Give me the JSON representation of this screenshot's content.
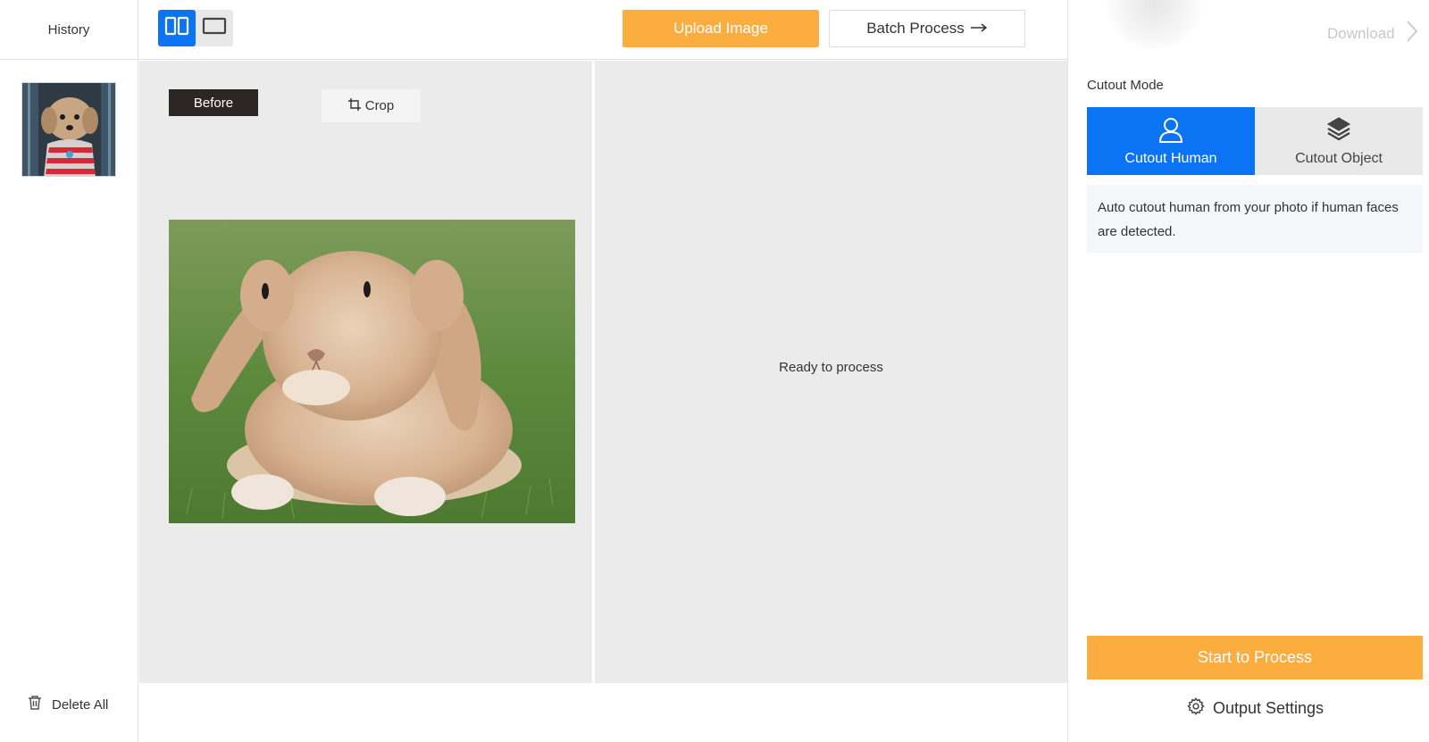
{
  "sidebar": {
    "title": "History",
    "delete_all_label": "Delete All"
  },
  "toolbar": {
    "view_modes": [
      "split-view",
      "single-view"
    ],
    "active_view": "split-view",
    "upload_label": "Upload Image",
    "batch_label": "Batch Process"
  },
  "workspace": {
    "before_label": "Before",
    "crop_label": "Crop",
    "status_text": "Ready to process"
  },
  "right_panel": {
    "download_label": "Download",
    "cutout_mode_label": "Cutout Mode",
    "modes": [
      {
        "label": "Cutout Human",
        "icon": "person-icon",
        "active": true
      },
      {
        "label": "Cutout Object",
        "icon": "layers-icon",
        "active": false
      }
    ],
    "mode_description": "Auto cutout human from your photo if human faces are detected.",
    "start_label": "Start to Process",
    "output_settings_label": "Output Settings"
  },
  "colors": {
    "accent_blue": "#0a74f5",
    "accent_orange": "#fbad3f",
    "pane_bg": "#ebebeb",
    "before_tag_bg": "#2b2523"
  }
}
